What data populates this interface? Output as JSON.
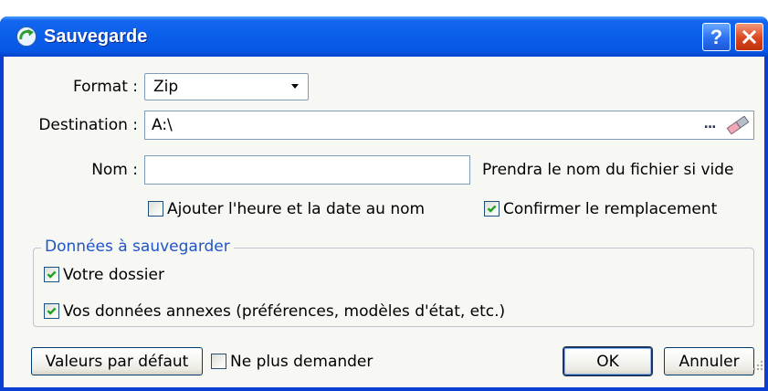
{
  "window": {
    "title": "Sauvegarde",
    "help_label": "?",
    "icons": {
      "app": "backup-app-icon",
      "help": "help-icon",
      "close": "close-icon"
    }
  },
  "format": {
    "label": "Format :",
    "value": "Zip",
    "icon": "chevron-down-icon"
  },
  "destination": {
    "label": "Destination :",
    "value": "A:\\",
    "browse_label": "...",
    "clear_icon": "eraser-icon"
  },
  "nom": {
    "label": "Nom :",
    "value": "",
    "hint": "Prendra le nom du fichier si vide"
  },
  "options": {
    "add_datetime": {
      "label": "Ajouter l'heure et la date au nom",
      "checked": false
    },
    "confirm_replace": {
      "label": "Confirmer le remplacement",
      "checked": true
    }
  },
  "data_group": {
    "legend": "Données à sauvegarder",
    "items": [
      {
        "label": "Votre dossier",
        "checked": true
      },
      {
        "label": "Vos données annexes (préférences, modèles d'état, etc.)",
        "checked": true
      }
    ]
  },
  "footer": {
    "defaults_label": "Valeurs par défaut",
    "no_ask": {
      "label": "Ne plus demander",
      "checked": false
    },
    "ok_label": "OK",
    "cancel_label": "Annuler",
    "resize_icon": "resize-grip-icon"
  },
  "colors": {
    "title_bar": "#0a5fe8",
    "frame": "#0b3fd4",
    "client_bg": "#f7f7f4",
    "legend_text": "#1f55c8",
    "checkmark": "#21a121",
    "close_button": "#d9451f",
    "help_button": "#2a6ff0",
    "field_border": "#7f9db9"
  }
}
